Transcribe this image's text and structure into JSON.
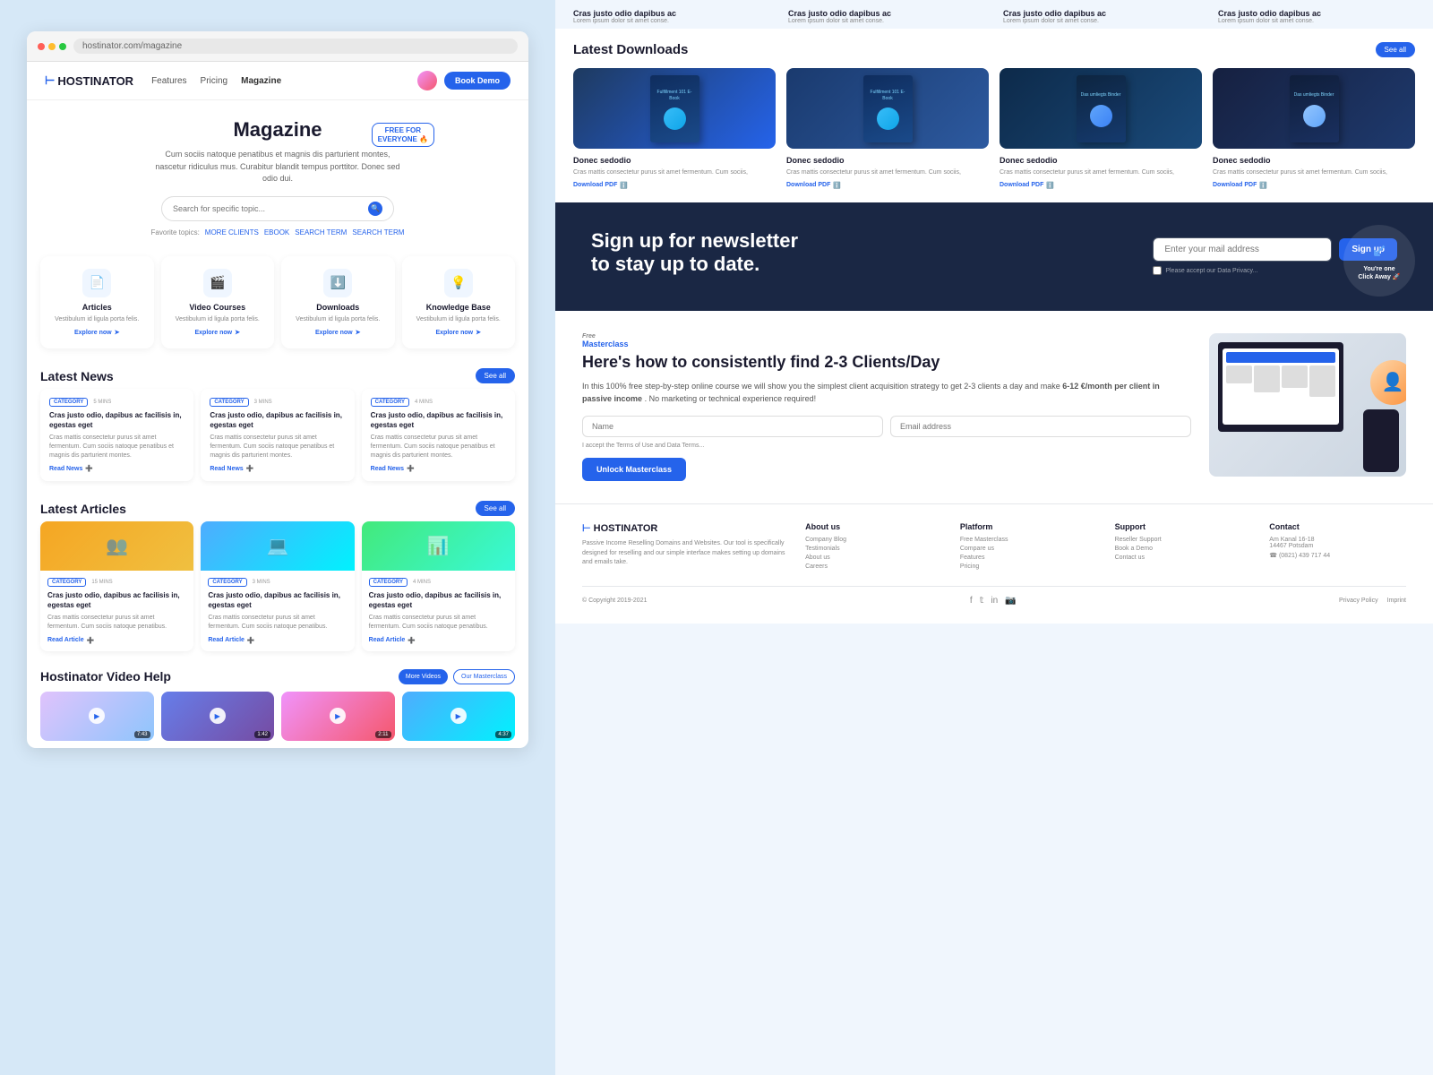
{
  "left": {
    "nav": {
      "logo": "HOSTINATOR",
      "logo_prefix": "H",
      "links": [
        "Features",
        "Pricing",
        "Magazine"
      ],
      "active_link": "Magazine",
      "book_demo": "Book Demo"
    },
    "hero": {
      "title": "Magazine",
      "subtitle": "Cum sociis natoque penatibus et magnis dis parturient montes, nascetur ridiculus mus. Curabitur blandit tempus porttitor. Donec sed odio dui.",
      "search_placeholder": "Search for specific topic...",
      "free_badge_line1": "FREE FOR",
      "free_badge_line2": "EVERYONE 🔥",
      "fav_label": "Favorite topics:",
      "tags": [
        "MORE CLIENTS",
        "EBOOK",
        "SEARCH TERM",
        "SEARCH TERM"
      ]
    },
    "categories": [
      {
        "icon": "📄",
        "title": "Articles",
        "desc": "Vestibulum id ligula porta felis.",
        "link": "Explore now"
      },
      {
        "icon": "🎬",
        "title": "Video Courses",
        "desc": "Vestibulum id ligula porta felis.",
        "link": "Explore now"
      },
      {
        "icon": "⬇️",
        "title": "Downloads",
        "desc": "Vestibulum id ligula porta felis.",
        "link": "Explore now"
      },
      {
        "icon": "💡",
        "title": "Knowledge Base",
        "desc": "Vestibulum id ligula porta felis.",
        "link": "Explore now"
      }
    ],
    "latest_news": {
      "title": "Latest News",
      "see_all": "See all",
      "items": [
        {
          "category": "CATEGORY",
          "time": "5 MINS",
          "title": "Cras justo odio, dapibus ac facilisis in, egestas eget",
          "desc": "Cras mattis consectetur purus sit amet fermentum. Cum sociis natoque penatibus et magnis dis parturient montes.",
          "link": "Read News"
        },
        {
          "category": "CATEGORY",
          "time": "3 MINS",
          "title": "Cras justo odio, dapibus ac facilisis in, egestas eget",
          "desc": "Cras mattis consectetur purus sit amet fermentum. Cum sociis natoque penatibus et magnis dis parturient montes.",
          "link": "Read News"
        },
        {
          "category": "CATEGORY",
          "time": "4 MINS",
          "title": "Cras justo odio, dapibus ac facilisis in, egestas eget",
          "desc": "Cras mattis consectetur purus sit amet fermentum. Cum sociis natoque penatibus et magnis dis parturient montes.",
          "link": "Read News"
        }
      ]
    },
    "latest_articles": {
      "title": "Latest Articles",
      "see_all": "See all",
      "items": [
        {
          "category": "CATEGORY",
          "time": "15 MINS",
          "title": "Cras justo odio, dapibus ac facilisis in, egestas eget",
          "desc": "Cras mattis consectetur purus sit amet fermentum. Cum sociis natoque penatibus.",
          "link": "Read Article"
        },
        {
          "category": "CATEGORY",
          "time": "3 MINS",
          "title": "Cras justo odio, dapibus ac facilisis in, egestas eget",
          "desc": "Cras mattis consectetur purus sit amet fermentum. Cum sociis natoque penatibus.",
          "link": "Read Article"
        },
        {
          "category": "CATEGORY",
          "time": "4 MINS",
          "title": "Cras justo odio, dapibus ac facilisis in, egestas eget",
          "desc": "Cras mattis consectetur purus sit amet fermentum. Cum sociis natoque penatibus.",
          "link": "Read Article"
        }
      ]
    },
    "video_help": {
      "title": "Hostinator Video Help",
      "more_videos": "More Videos",
      "masterclass": "Our Masterclass",
      "videos": [
        {
          "duration": "7:43"
        },
        {
          "duration": "1:42"
        },
        {
          "duration": "2:11"
        },
        {
          "duration": "4:37"
        }
      ]
    }
  },
  "right": {
    "top_cards": [
      {
        "title": "Cras justo odio dapibus ac",
        "desc": "Lorem ipsum dolor sit amet conse."
      },
      {
        "title": "Cras justo odio dapibus ac",
        "desc": "Lorem ipsum dolor sit amet conse."
      },
      {
        "title": "Cras justo odio dapibus ac",
        "desc": "Lorem ipsum dolor sit amet conse."
      },
      {
        "title": "Cras justo odio dapibus ac",
        "desc": "Lorem ipsum dolor sit amet conse."
      }
    ],
    "downloads": {
      "title": "Latest Downloads",
      "see_all": "See all",
      "items": [
        {
          "label": "Fulfillment 101 E-Book",
          "name": "Donec sedodio",
          "desc": "Cras mattis consectetur purus sit amet fermentum. Cum sociis,",
          "link": "Download PDF"
        },
        {
          "label": "Fulfillment 101 E-Book",
          "name": "Donec sedodio",
          "desc": "Cras mattis consectetur purus sit amet fermentum. Cum sociis,",
          "link": "Download PDF"
        },
        {
          "label": "Das umliegts Binder",
          "name": "Donec sedodio",
          "desc": "Cras mattis consectetur purus sit amet fermentum. Cum sociis,",
          "link": "Download PDF"
        },
        {
          "label": "Das umliegts Binder",
          "name": "Donec sedodio",
          "desc": "Cras mattis consectetur purus sit amet fermentum. Cum sociis,",
          "link": "Download PDF"
        }
      ]
    },
    "newsletter": {
      "title_line1": "Sign up for newsletter",
      "title_line2": "to stay up to date.",
      "email_placeholder": "Enter your mail address",
      "signup_btn": "Sign up",
      "privacy_text": "Please accept our Data Privacy...",
      "click_away": "You're one\nClick Away 🚀"
    },
    "masterclass": {
      "badge": "Free\nMasterclass",
      "title": "Here's how to consistently find 2-3 Clients/Day",
      "desc_part1": "In this 100% free step-by-step online course we will show you the simplest client acquisition strategy to get 2-3 clients a day and make ",
      "highlight": "6-12 €/month per client in passive income",
      "desc_part2": ". No marketing or technical experience required!",
      "name_placeholder": "Name",
      "email_placeholder": "Email address",
      "terms": "I accept the Terms of Use and Data Terms...",
      "unlock_btn": "Unlock Masterclass"
    },
    "footer": {
      "logo": "HOSTINATOR",
      "brand_desc": "Passive Income Reselling Domains and Websites. Our tool is specifically designed for reselling and our simple interface makes setting up domains and emails take.",
      "columns": [
        {
          "title": "About us",
          "links": [
            "Company Blog",
            "Testimonials",
            "About us",
            "Careers"
          ]
        },
        {
          "title": "Platform",
          "links": [
            "Free Masterclass",
            "Compare us",
            "Features",
            "Pricing"
          ]
        },
        {
          "title": "Support",
          "links": [
            "Reseller Support",
            "Book a Demo",
            "Contact us"
          ]
        },
        {
          "title": "Contact",
          "address": "Am Kanal 16-18\n14467 Potsdam",
          "phone": "☎ (0821) 439 717 44"
        }
      ],
      "copyright": "© Copyright 2019-2021",
      "social": [
        "f",
        "t",
        "in",
        "ig"
      ],
      "policy_links": [
        "Privacy Policy",
        "Imprint"
      ]
    }
  }
}
